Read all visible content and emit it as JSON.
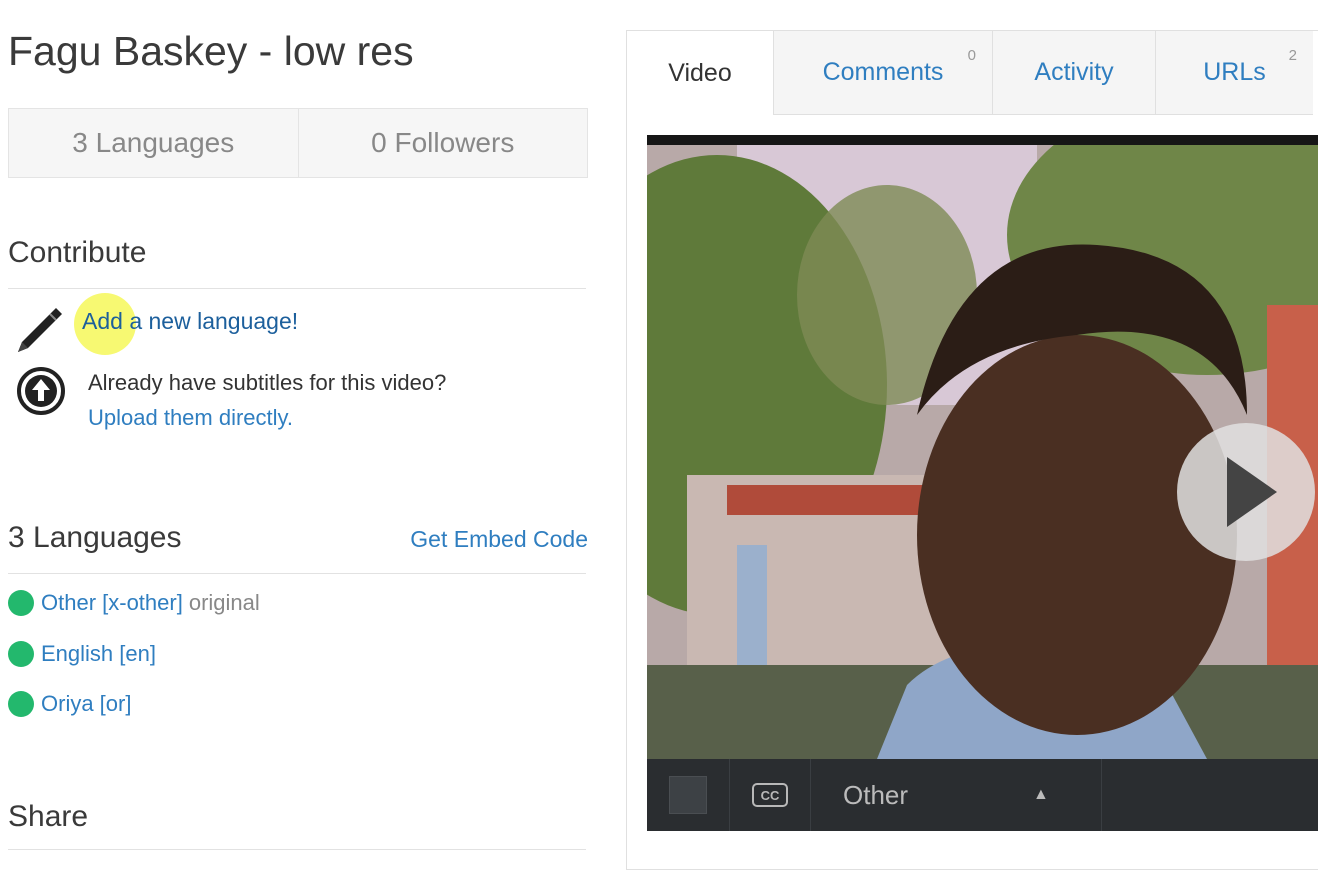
{
  "video_title": "Fagu Baskey - low res",
  "stats": {
    "languages": "3 Languages",
    "followers": "0 Followers"
  },
  "contribute": {
    "heading": "Contribute",
    "add_language": "Add a new language!",
    "upload_question": "Already have subtitles for this video?",
    "upload_link": "Upload them directly."
  },
  "languages": {
    "heading": "3 Languages",
    "embed_link": "Get Embed Code",
    "items": [
      {
        "label": "Other [x-other]",
        "note": "original"
      },
      {
        "label": "English [en]",
        "note": ""
      },
      {
        "label": "Oriya [or]",
        "note": ""
      }
    ]
  },
  "share": {
    "heading": "Share"
  },
  "tabs": [
    {
      "label": "Video",
      "count": ""
    },
    {
      "label": "Comments",
      "count": "0"
    },
    {
      "label": "Activity",
      "count": ""
    },
    {
      "label": "URLs",
      "count": "2"
    }
  ],
  "player": {
    "cc_label": "CC",
    "subtitle_language": "Other"
  },
  "colors": {
    "link": "#2f7ec0",
    "status_dot": "#23b86d",
    "highlight": "#f7f96a"
  }
}
